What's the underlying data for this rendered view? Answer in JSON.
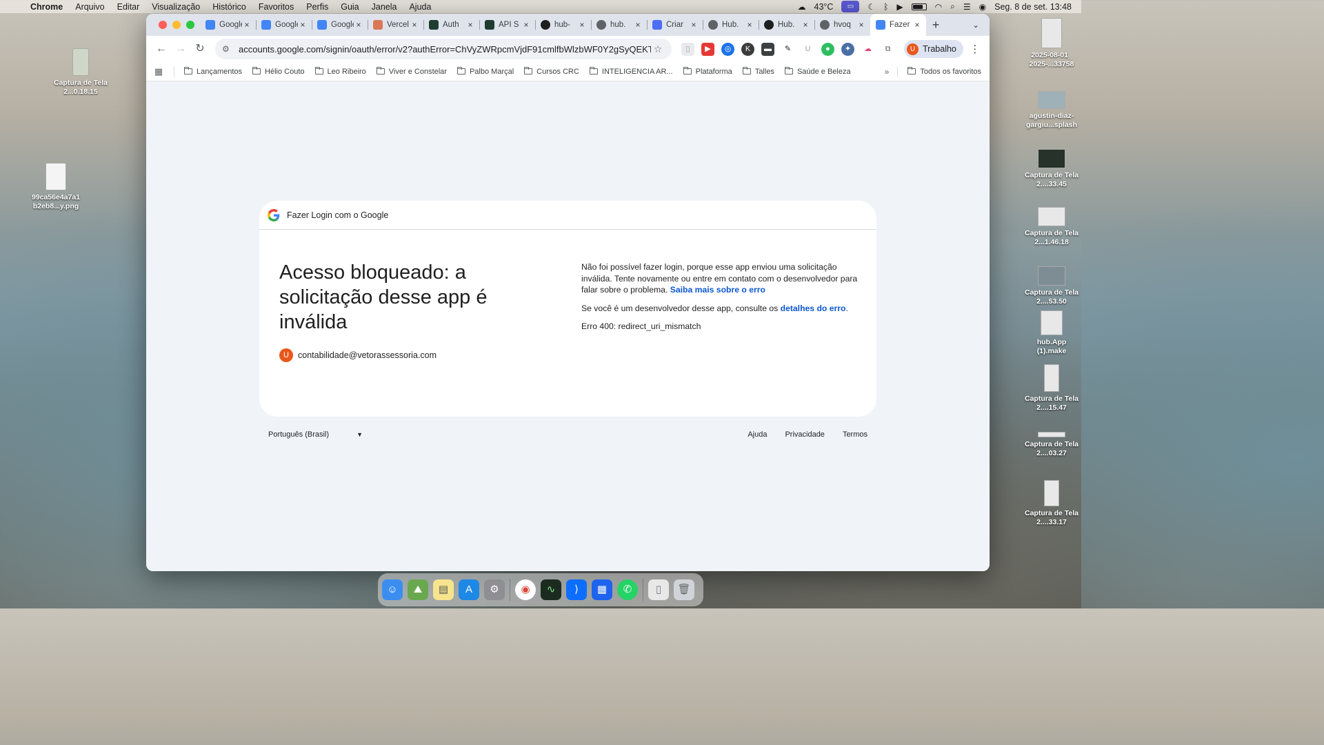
{
  "menubar": {
    "app_name": "Chrome",
    "menus": [
      "Arquivo",
      "Editar",
      "Visualização",
      "Histórico",
      "Favoritos",
      "Perfis",
      "Guia",
      "Janela",
      "Ajuda"
    ],
    "temperature": "43°C",
    "datetime": "Seg. 8 de set.  13:48"
  },
  "desktop": {
    "left_icons": [
      {
        "label": "Captura de Tela 2...0.18.15"
      },
      {
        "label": "99ca56e4a7a1 b2eb8...y.png"
      }
    ],
    "right_icons": [
      {
        "label": "2025-08-01_ 2025-...33758"
      },
      {
        "label": "agustin-diaz- gargiu...splash"
      },
      {
        "label": "Captura de Tela 2....33.45"
      },
      {
        "label": "Captura de Tela 2...1.46.18"
      },
      {
        "label": "Captura de Tela 2....53.50"
      },
      {
        "label": "hub.App (1).make"
      },
      {
        "label": "Captura de Tela 2....15.47"
      },
      {
        "label": "Captura de Tela 2....03.27"
      },
      {
        "label": "Captura de Tela 2....33.17"
      }
    ]
  },
  "browser": {
    "tabs": [
      {
        "label": "Google",
        "icon": "gemini-icon",
        "color": "#4285f4"
      },
      {
        "label": "Google",
        "icon": "gemini-icon",
        "color": "#4285f4"
      },
      {
        "label": "Google",
        "icon": "gemini-icon",
        "color": "#4285f4"
      },
      {
        "label": "Vercel",
        "icon": "claude-icon",
        "color": "#d97757"
      },
      {
        "label": "Auth",
        "icon": "pulse-icon",
        "color": "#1e3d2f"
      },
      {
        "label": "API S",
        "icon": "pulse-icon",
        "color": "#1e3d2f"
      },
      {
        "label": "hub-",
        "icon": "github-icon",
        "color": "#1f1f1f"
      },
      {
        "label": "hub.",
        "icon": "globe-icon",
        "color": "#5f6368"
      },
      {
        "label": "Criar",
        "icon": "shield-icon",
        "color": "#4c6ef5"
      },
      {
        "label": "Hub.",
        "icon": "globe-icon",
        "color": "#5f6368"
      },
      {
        "label": "Hub.",
        "icon": "github-icon",
        "color": "#1f1f1f"
      },
      {
        "label": "hvoq",
        "icon": "globe-icon",
        "color": "#5f6368"
      },
      {
        "label": "Fazer",
        "icon": "google-icon",
        "color": "#4285f4",
        "active": true
      }
    ],
    "url": "accounts.google.com/signin/oauth/error/v2?authError=ChVyZWRpcmVjdF91cmlfbWlzbWF0Y2gSyQEKTsOjby...",
    "profile_label": "Trabalho",
    "profile_initial": "U",
    "bookmarks": [
      "Lançamentos",
      "Hélio Couto",
      "Leo Ribeiro",
      "Viver e Constelar",
      "Palbo Marçal",
      "Cursos CRC",
      "INTELIGENCIA AR...",
      "Plataforma",
      "Talles",
      "Saúde e Beleza"
    ],
    "all_bookmarks": "Todos os favoritos"
  },
  "page": {
    "header": "Fazer Login com o Google",
    "title": "Acesso bloqueado: a solicitação desse app é inválida",
    "account_initial": "U",
    "account_email": "contabilidade@vetorassessoria.com",
    "message": "Não foi possível fazer login, porque esse app enviou uma solicitação inválida. Tente novamente ou entre em contato com o desenvolvedor para falar sobre o problema.",
    "learn_more": "Saiba mais sobre o erro",
    "dev_message": "Se você é um desenvolvedor desse app, consulte os",
    "dev_link": "detalhes do erro",
    "error_code": "Erro 400: redirect_uri_mismatch",
    "language": "Português (Brasil)",
    "footer_links": [
      "Ajuda",
      "Privacidade",
      "Termos"
    ]
  },
  "colors": {
    "accent_link": "#0b57d0",
    "avatar": "#e8581c",
    "page_bg": "#f0f4f9"
  }
}
